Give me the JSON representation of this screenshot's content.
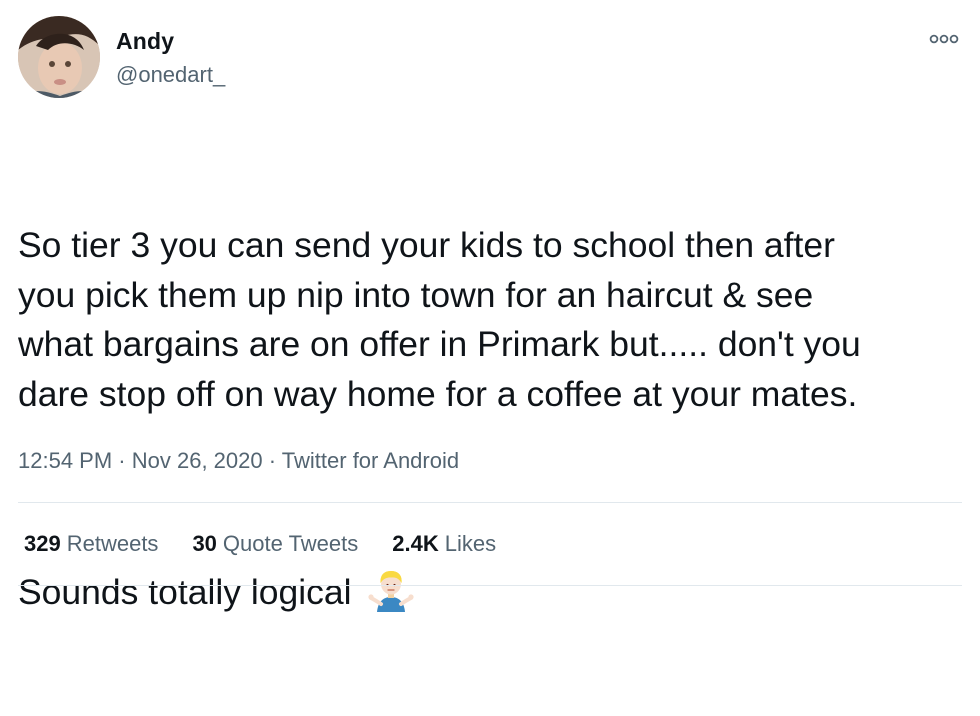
{
  "author": {
    "display_name": "Andy",
    "handle": "@onedart_"
  },
  "tweet": {
    "paragraph_1": "So tier 3 you can send your kids to school then after\nyou pick them up nip into town for an haircut & see\nwhat bargains are on offer in Primark but..... don't you\ndare stop off on way home for a coffee at your mates.",
    "paragraph_2": "Sounds totally logical",
    "emoji_icon": "man-shrugging-icon"
  },
  "meta": {
    "time": "12:54 PM",
    "separator": "·",
    "date": "Nov 26, 2020",
    "source": "Twitter for Android"
  },
  "stats": {
    "retweets_count": "329",
    "retweets_label": "Retweets",
    "quotes_count": "30",
    "quotes_label": "Quote Tweets",
    "likes_count": "2.4K",
    "likes_label": "Likes"
  },
  "colors": {
    "text": "#0f1419",
    "secondary": "#536471",
    "divider": "#e1e8ed"
  }
}
